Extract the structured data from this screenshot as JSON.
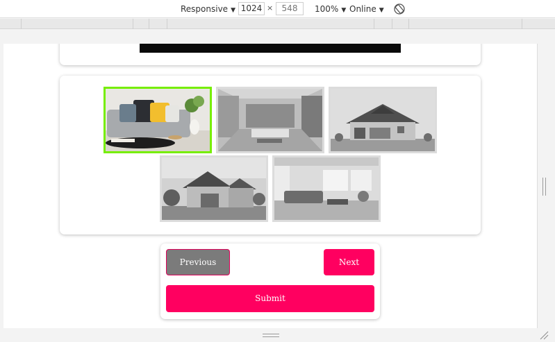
{
  "toolbar": {
    "device_mode": "Responsive",
    "width": "1024",
    "height": "548",
    "separator": "×",
    "zoom": "100%",
    "network": "Online",
    "caret": "▼"
  },
  "gallery": {
    "images": [
      {
        "subject": "living room with pillows (color)",
        "selected": true
      },
      {
        "subject": "modern living room (grayscale)",
        "selected": false
      },
      {
        "subject": "house exterior (grayscale)",
        "selected": false
      },
      {
        "subject": "house exterior (grayscale)",
        "selected": false
      },
      {
        "subject": "living room interior (grayscale)",
        "selected": false
      }
    ],
    "selected_border_color": "#76ee00"
  },
  "nav": {
    "previous_label": "Previous",
    "next_label": "Next",
    "submit_label": "Submit",
    "accent_color": "#ff0060"
  }
}
